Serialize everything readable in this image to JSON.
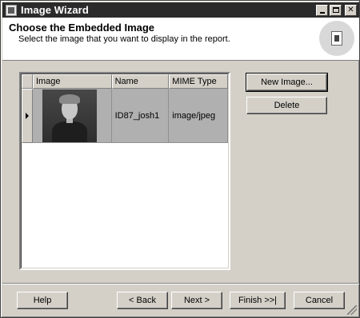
{
  "window": {
    "title": "Image Wizard",
    "controls": {
      "minimize": "_",
      "maximize": "□",
      "close": "✕"
    }
  },
  "header": {
    "title": "Choose the Embedded Image",
    "subtitle": "Select the image that you want to display in the report.",
    "graphic_icon": "wizard-image-icon"
  },
  "grid": {
    "columns": [
      "Image",
      "Name",
      "MIME Type"
    ],
    "rows": [
      {
        "image_icon": "photo-thumbnail",
        "name": "ID87_josh1",
        "mime_type": "image/jpeg",
        "selected": true
      }
    ]
  },
  "side_buttons": {
    "new_image": "New Image...",
    "delete": "Delete"
  },
  "footer_buttons": {
    "help": "Help",
    "back": "< Back",
    "next": "Next >",
    "finish": "Finish >>|",
    "cancel": "Cancel"
  },
  "colors": {
    "titlebar": "#2b2b2b",
    "dialog": "#d4d0c8",
    "row_selected": "#b0b0b0"
  }
}
